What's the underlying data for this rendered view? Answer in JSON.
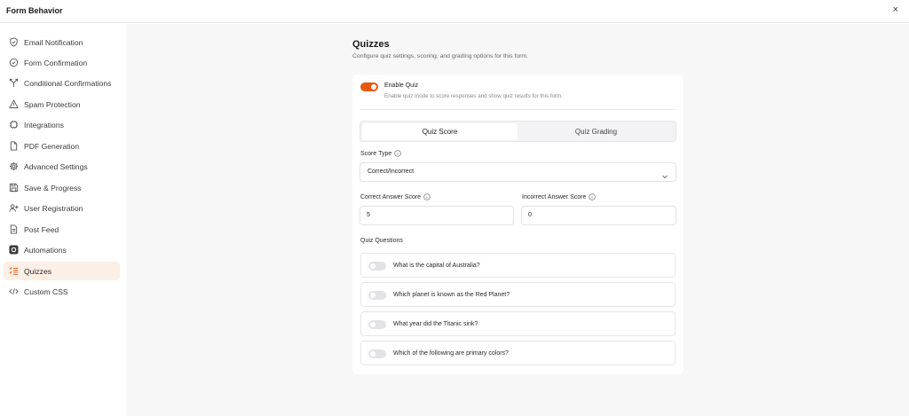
{
  "header": {
    "title": "Form Behavior",
    "close_symbol": "×"
  },
  "sidebar": {
    "items": [
      {
        "label": "Email Notification",
        "icon": "shield-check-icon"
      },
      {
        "label": "Form Confirmation",
        "icon": "check-circle-icon"
      },
      {
        "label": "Conditional Confirmations",
        "icon": "split-icon"
      },
      {
        "label": "Spam Protection",
        "icon": "alert-triangle-icon"
      },
      {
        "label": "Integrations",
        "icon": "plug-icon"
      },
      {
        "label": "PDF Generation",
        "icon": "file-icon"
      },
      {
        "label": "Advanced Settings",
        "icon": "gear-icon"
      },
      {
        "label": "Save & Progress",
        "icon": "save-icon"
      },
      {
        "label": "User Registration",
        "icon": "user-plus-icon"
      },
      {
        "label": "Post Feed",
        "icon": "document-icon"
      },
      {
        "label": "Automations",
        "icon": "automation-icon"
      },
      {
        "label": "Quizzes",
        "icon": "list-check-icon",
        "active": true
      },
      {
        "label": "Custom CSS",
        "icon": "code-icon"
      }
    ]
  },
  "main": {
    "title": "Quizzes",
    "subtitle": "Configure quiz settings, scoring, and grading options for this form.",
    "enable_quiz": {
      "label": "Enable Quiz",
      "description": "Enable quiz mode to score responses and show quiz results for this form.",
      "enabled": true
    },
    "tabs": [
      {
        "label": "Quiz Score",
        "active": true
      },
      {
        "label": "Quiz Grading",
        "active": false
      }
    ],
    "score_type": {
      "label": "Score Type",
      "value": "Correct/Incorrect"
    },
    "correct_score": {
      "label": "Correct Answer Score",
      "value": "5"
    },
    "incorrect_score": {
      "label": "Incorrect Answer Score",
      "value": "0"
    },
    "questions_label": "Quiz Questions",
    "questions": [
      {
        "text": "What is the capital of Australia?",
        "enabled": false
      },
      {
        "text": "Which planet is known as the Red Planet?",
        "enabled": false
      },
      {
        "text": "What year did the Titanic sink?",
        "enabled": false
      },
      {
        "text": "Which of the following are primary colors?",
        "enabled": false
      }
    ]
  },
  "colors": {
    "accent": "#e8590c",
    "active_bg": "#fcefe6",
    "main_bg": "#f7f7f8"
  }
}
